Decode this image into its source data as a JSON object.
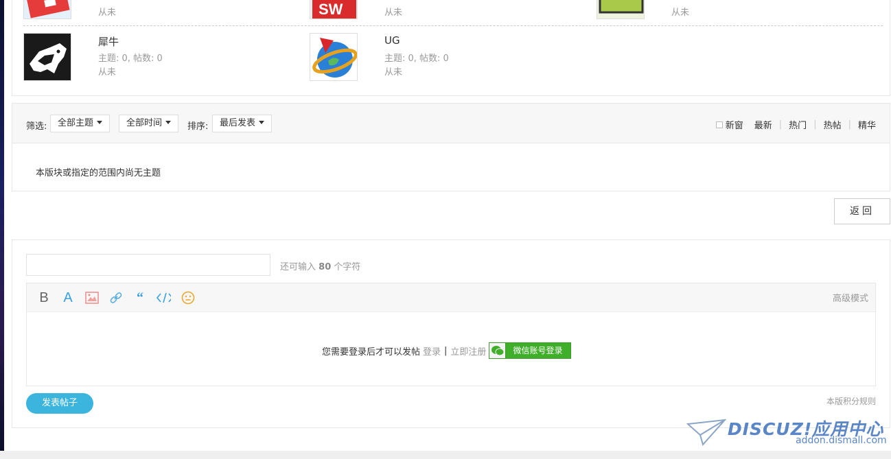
{
  "forums": {
    "row1": [
      {
        "last_post": "从未",
        "icon": "solidworks-icon"
      },
      {
        "last_post": "从未",
        "icon": "solidworks-sw-icon"
      },
      {
        "last_post": "从未",
        "icon": "green-app-icon"
      }
    ],
    "row2": [
      {
        "name": "犀牛",
        "stats": "主题: 0, 帖数: 0",
        "last_post": "从未",
        "icon": "rhino-icon"
      },
      {
        "name": "UG",
        "stats": "主题: 0, 帖数: 0",
        "last_post": "从未",
        "icon": "ug-globe-icon"
      }
    ]
  },
  "filter": {
    "label": "筛选:",
    "theme_dropdown": "全部主题",
    "time_dropdown": "全部时间",
    "sort_label": "排序:",
    "sort_dropdown": "最后发表",
    "new_window": "新窗",
    "links": [
      "最新",
      "热门",
      "热帖",
      "精华"
    ]
  },
  "empty_message": "本版块或指定的范围内尚无主题",
  "back_button": "返回",
  "post": {
    "title_placeholder": "",
    "remaining_prefix": "还可输入",
    "remaining_count": "80",
    "remaining_suffix": "个字符",
    "advanced_mode": "高级模式",
    "login_prompt": "您需要登录后才可以发帖",
    "login_link": "登录",
    "separator": "|",
    "register_link": "立即注册",
    "wechat_login": "微信账号登录",
    "submit": "发表帖子",
    "rules_link": "本版积分规则"
  },
  "watermark": {
    "name": "DISCUZ!应用中心",
    "url": "addon.dismall.com"
  },
  "colors": {
    "accent": "#3cb5de",
    "wechat_green": "#3fae29",
    "watermark": "#5a86c8"
  }
}
